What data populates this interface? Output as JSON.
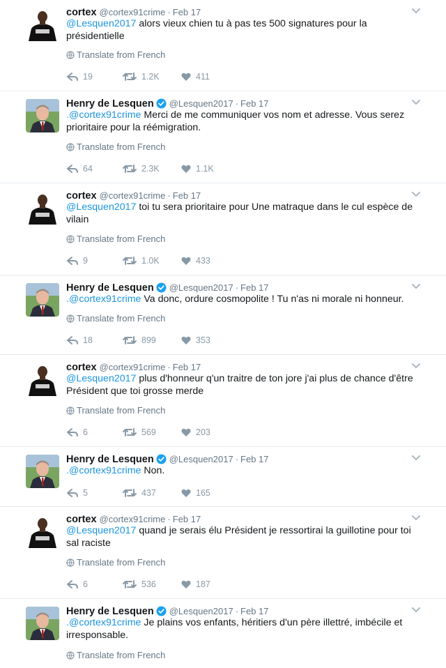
{
  "colors": {
    "link": "#1b95e0",
    "muted": "#657786",
    "verified": "#1da1f2"
  },
  "translate_label": "Translate from French",
  "tweets": [
    {
      "name": "cortex",
      "verified": false,
      "handle": "@cortex91crime",
      "date": "Feb 17",
      "avatar": "cortex",
      "mention": "@Lesquen2017",
      "body": " alors vieux chien tu à pas tes 500 signatures pour la présidentielle",
      "has_translate": true,
      "replies": "19",
      "retweets": "1.2K",
      "likes": "411"
    },
    {
      "name": "Henry de Lesquen",
      "verified": true,
      "handle": "@Lesquen2017",
      "date": "Feb 17",
      "avatar": "lesquen",
      "mention": ".@cortex91crime",
      "body": " Merci de me communiquer vos nom et adresse. Vous serez prioritaire pour la réémigration.",
      "has_translate": true,
      "replies": "64",
      "retweets": "2.3K",
      "likes": "1.1K"
    },
    {
      "name": "cortex",
      "verified": false,
      "handle": "@cortex91crime",
      "date": "Feb 17",
      "avatar": "cortex",
      "mention": "@Lesquen2017",
      "body": " toi tu sera prioritaire pour Une matraque dans le cul espèce de vilain",
      "has_translate": true,
      "replies": "9",
      "retweets": "1.0K",
      "likes": "433"
    },
    {
      "name": "Henry de Lesquen",
      "verified": true,
      "handle": "@Lesquen2017",
      "date": "Feb 17",
      "avatar": "lesquen",
      "mention": ".@cortex91crime",
      "body": " Va donc, ordure cosmopolite ! Tu n'as ni morale ni honneur.",
      "has_translate": true,
      "replies": "18",
      "retweets": "899",
      "likes": "353"
    },
    {
      "name": "cortex",
      "verified": false,
      "handle": "@cortex91crime",
      "date": "Feb 17",
      "avatar": "cortex",
      "mention": "@Lesquen2017",
      "body": " plus d'honneur q'un traitre de ton jore j'ai plus de chance d'être Président que toi grosse merde",
      "has_translate": true,
      "replies": "6",
      "retweets": "569",
      "likes": "203"
    },
    {
      "name": "Henry de Lesquen",
      "verified": true,
      "handle": "@Lesquen2017",
      "date": "Feb 17",
      "avatar": "lesquen",
      "mention": ".@cortex91crime",
      "body": " Non.",
      "has_translate": false,
      "replies": "5",
      "retweets": "437",
      "likes": "165"
    },
    {
      "name": "cortex",
      "verified": false,
      "handle": "@cortex91crime",
      "date": "Feb 17",
      "avatar": "cortex",
      "mention": "@Lesquen2017",
      "body": " quand je serais élu Président je ressortirai la guillotine pour toi sal raciste",
      "has_translate": true,
      "replies": "6",
      "retweets": "536",
      "likes": "187"
    },
    {
      "name": "Henry de Lesquen",
      "verified": true,
      "handle": "@Lesquen2017",
      "date": "Feb 17",
      "avatar": "lesquen",
      "mention": ".@cortex91crime",
      "body": " Je plains vos enfants, héritiers d'un père illettré, imbécile et irresponsable.",
      "has_translate": true,
      "replies": "",
      "retweets": "",
      "likes": ""
    }
  ]
}
